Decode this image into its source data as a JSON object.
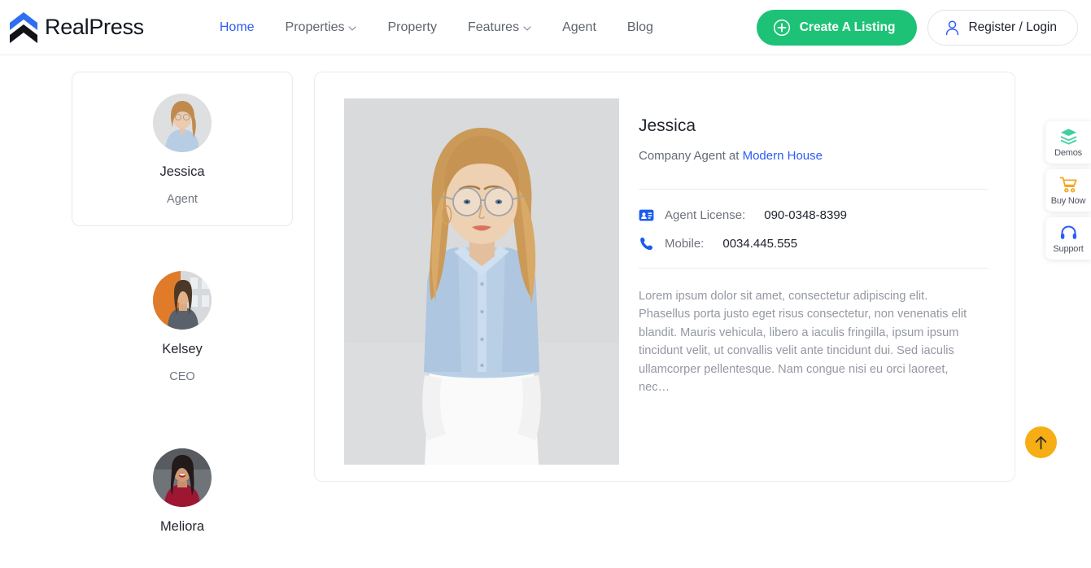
{
  "header": {
    "brand": {
      "name": "RealPress",
      "logo_icon": "double-chevron-logo",
      "color_top": "#2f6ef0",
      "color_bottom": "#111318"
    },
    "nav": [
      {
        "label": "Home",
        "active": true,
        "caret": false
      },
      {
        "label": "Properties",
        "active": false,
        "caret": true
      },
      {
        "label": "Property",
        "active": false,
        "caret": false
      },
      {
        "label": "Features",
        "active": false,
        "caret": true
      },
      {
        "label": "Agent",
        "active": false,
        "caret": false
      },
      {
        "label": "Blog",
        "active": false,
        "caret": false
      }
    ],
    "create_button": {
      "label": "Create A Listing",
      "icon": "plus-circle-icon",
      "color": "#1ec277"
    },
    "register_button": {
      "label": "Register / Login",
      "icon": "user-icon",
      "icon_color": "#2b5cf6"
    }
  },
  "sidebar": {
    "agents": [
      {
        "name": "Jessica",
        "role": "Agent",
        "selected": true
      },
      {
        "name": "Kelsey",
        "role": "CEO",
        "selected": false
      },
      {
        "name": "Meliora",
        "role": "",
        "selected": false
      }
    ]
  },
  "detail": {
    "name": "Jessica",
    "company_prefix": "Company Agent at",
    "company_link": "Modern House",
    "info": [
      {
        "icon": "id-card-icon",
        "label": "Agent License:",
        "value": "090-0348-8399"
      },
      {
        "icon": "phone-icon",
        "label": "Mobile:",
        "value": "0034.445.555"
      }
    ],
    "description": "Lorem ipsum dolor sit amet, consectetur adipiscing elit. Phasellus porta justo eget risus consectetur, non venenatis elit blandit. Mauris vehicula, libero a iaculis fringilla, ipsum ipsum tincidunt velit, ut convallis velit ante tincidunt dui. Sed iaculis ullamcorper pellentesque. Nam congue nisi eu orci laoreet, nec…"
  },
  "float_widgets": [
    {
      "label": "Demos",
      "icon": "layers-icon",
      "color": "#3fcfa0"
    },
    {
      "label": "Buy Now",
      "icon": "cart-icon",
      "color": "#f5a623"
    },
    {
      "label": "Support",
      "icon": "headset-icon",
      "color": "#2b5cf6"
    }
  ],
  "scroll_top": {
    "icon": "arrow-up-icon",
    "color": "#f6ae14"
  }
}
